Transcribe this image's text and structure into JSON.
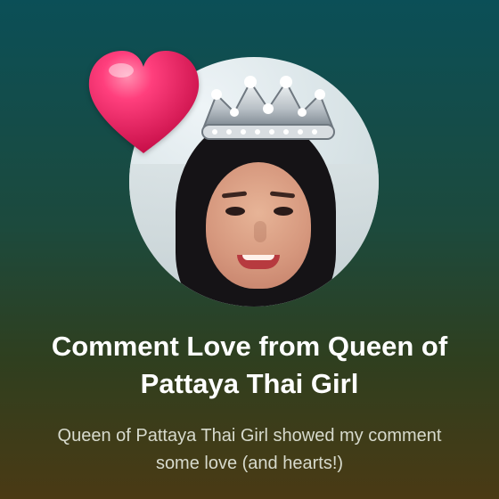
{
  "card": {
    "title": "Comment Love from Queen of Pattaya Thai Girl",
    "subtitle": "Queen of Pattaya Thai Girl showed my comment some love (and hearts!)",
    "icon": "heart-icon",
    "avatar_label": "profile-photo"
  },
  "colors": {
    "background_top": "#0b4f57",
    "background_bottom": "#4a3a14",
    "heart": "#e61d5d",
    "title_text": "#ffffff",
    "subtitle_text": "#d7dacd"
  }
}
